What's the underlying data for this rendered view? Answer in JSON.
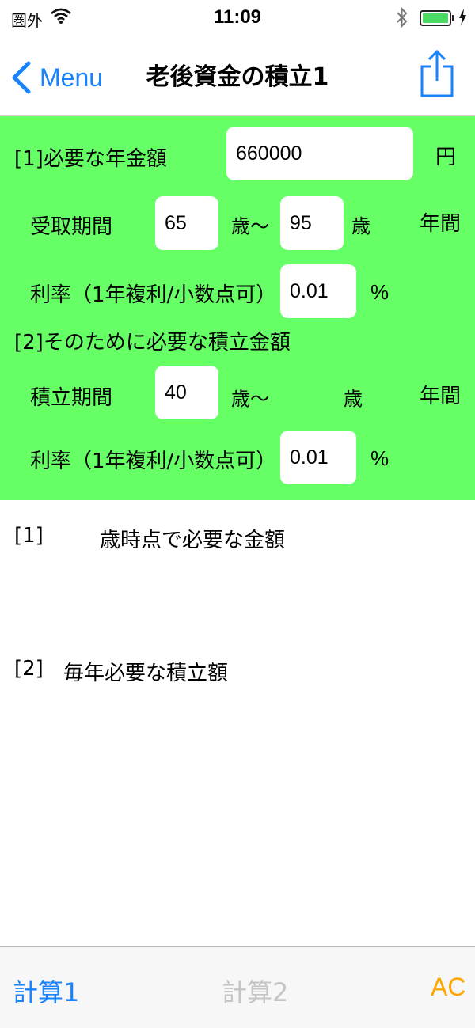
{
  "status": {
    "carrier": "圏外",
    "time": "11:09"
  },
  "nav": {
    "back_label": "Menu",
    "title": "老後資金の積立1"
  },
  "form": {
    "section1_label": "[1]必要な年金額",
    "annual_amount": "660000",
    "yen_unit": "円",
    "receive_label": "受取期間",
    "receive_start": "65",
    "age_from_unit": "歳〜",
    "receive_end": "95",
    "age_unit": "歳",
    "years_unit": "年間",
    "rate_label": "利率（1年複利/小数点可）",
    "rate1": "0.01",
    "percent": "%",
    "section2_label": "[2]そのために必要な積立金額",
    "accum_label": "積立期間",
    "accum_start": "40",
    "accum_age_from_unit": "歳〜",
    "accum_age_unit": "歳",
    "accum_years_unit": "年間",
    "rate2_label": "利率（1年複利/小数点可）",
    "rate2": "0.01",
    "percent2": "%"
  },
  "results": {
    "r1_tag": "[1]",
    "r1_text": "歳時点で必要な金額",
    "r2_tag": "[2]",
    "r2_text": "毎年必要な積立額"
  },
  "tabs": {
    "calc1": "計算1",
    "calc2": "計算2",
    "ac": "AC"
  },
  "colors": {
    "accent_blue": "#1a82fb",
    "panel_green": "#66ff66",
    "ac_orange": "#ffa500",
    "disabled_gray": "#c4c4c4"
  }
}
